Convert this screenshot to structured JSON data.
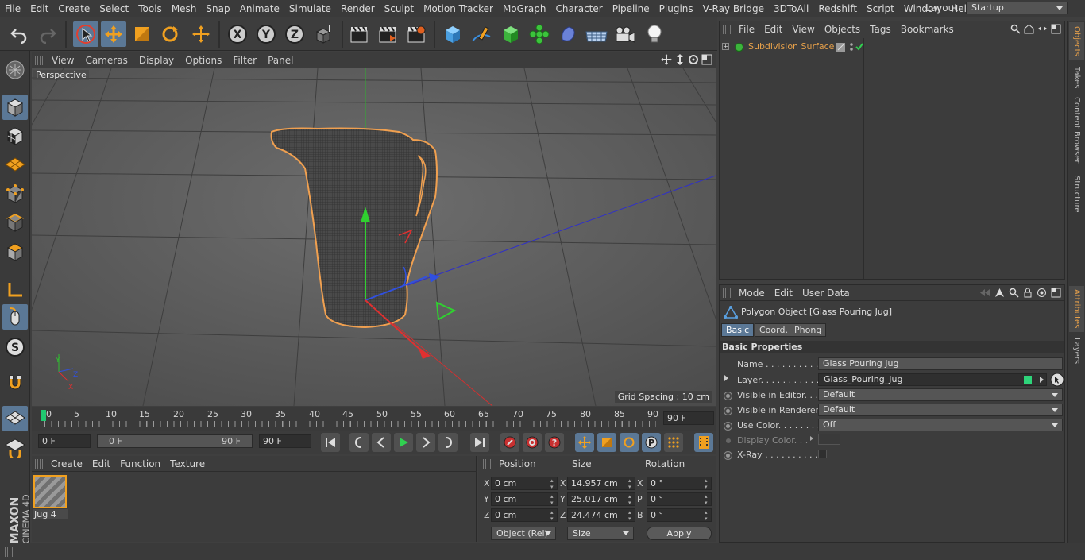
{
  "menubar": {
    "items": [
      "File",
      "Edit",
      "Create",
      "Select",
      "Tools",
      "Mesh",
      "Snap",
      "Animate",
      "Simulate",
      "Render",
      "Sculpt",
      "Motion Tracker",
      "MoGraph",
      "Character",
      "Pipeline",
      "Plugins",
      "V-Ray Bridge",
      "3DToAll",
      "Redshift",
      "Script",
      "Window",
      "Help"
    ],
    "layout_label": "Layout:",
    "layout_value": "Startup"
  },
  "viewport": {
    "menu": [
      "View",
      "Cameras",
      "Display",
      "Options",
      "Filter",
      "Panel"
    ],
    "label": "Perspective",
    "grid_spacing": "Grid Spacing : 10 cm"
  },
  "timeline": {
    "ticks": [
      "0",
      "5",
      "10",
      "15",
      "20",
      "25",
      "30",
      "35",
      "40",
      "45",
      "50",
      "55",
      "60",
      "65",
      "70",
      "75",
      "80",
      "85",
      "90"
    ],
    "current_frame": "90 F"
  },
  "playbar": {
    "start": "0 F",
    "range_start": "0 F",
    "range_end": "90 F",
    "end": "90 F"
  },
  "materials": {
    "menu": [
      "Create",
      "Edit",
      "Function",
      "Texture"
    ],
    "items": [
      {
        "name": "Jug 4"
      }
    ]
  },
  "coords": {
    "headers": {
      "position": "Position",
      "size": "Size",
      "rotation": "Rotation"
    },
    "rows": [
      {
        "axis": "X",
        "pos": "0 cm",
        "size_axis": "X",
        "size": "14.957 cm",
        "rot_axis": "X",
        "rot": "0 °"
      },
      {
        "axis": "Y",
        "pos": "0 cm",
        "size_axis": "Y",
        "size": "25.017 cm",
        "rot_axis": "P",
        "rot": "0 °"
      },
      {
        "axis": "Z",
        "pos": "0 cm",
        "size_axis": "Z",
        "size": "24.474 cm",
        "rot_axis": "B",
        "rot": "0 °"
      }
    ],
    "mode": "Object (Rel)",
    "size_mode": "Size",
    "apply": "Apply"
  },
  "objects": {
    "menu": [
      "File",
      "Edit",
      "View",
      "Objects",
      "Tags",
      "Bookmarks"
    ],
    "items": [
      {
        "name": "Subdivision Surface"
      }
    ]
  },
  "attributes": {
    "menu": [
      "Mode",
      "Edit",
      "User Data"
    ],
    "object_title": "Polygon Object [Glass Pouring Jug]",
    "tabs": [
      "Basic",
      "Coord.",
      "Phong"
    ],
    "section": "Basic Properties",
    "props": [
      {
        "label": "Name . . . . . . . . . . . .",
        "value": "Glass Pouring Jug",
        "type": "text"
      },
      {
        "label": "Layer. . . . . . . . . . . .",
        "value": "Glass_Pouring_Jug",
        "type": "layer"
      },
      {
        "label": "Visible in Editor. . .",
        "value": "Default",
        "type": "drop"
      },
      {
        "label": "Visible in Renderer",
        "value": "Default",
        "type": "drop"
      },
      {
        "label": "Use Color. . . . . . . .",
        "value": "Off",
        "type": "drop"
      },
      {
        "label": "Display Color. . .",
        "value": "",
        "type": "color"
      },
      {
        "label": "X-Ray . . . . . . . . . . .",
        "value": "",
        "type": "check"
      }
    ]
  },
  "right_tabs": {
    "top": [
      "Objects",
      "Takes",
      "Content Browser",
      "Structure"
    ],
    "bottom": [
      "Attributes",
      "Layers"
    ]
  },
  "brand": {
    "maxon": "MAXON",
    "c4d": "CINEMA 4D"
  },
  "colors": {
    "accent": "#5b7896",
    "orange": "#e6a04a",
    "layer_green": "#2ed47a"
  }
}
